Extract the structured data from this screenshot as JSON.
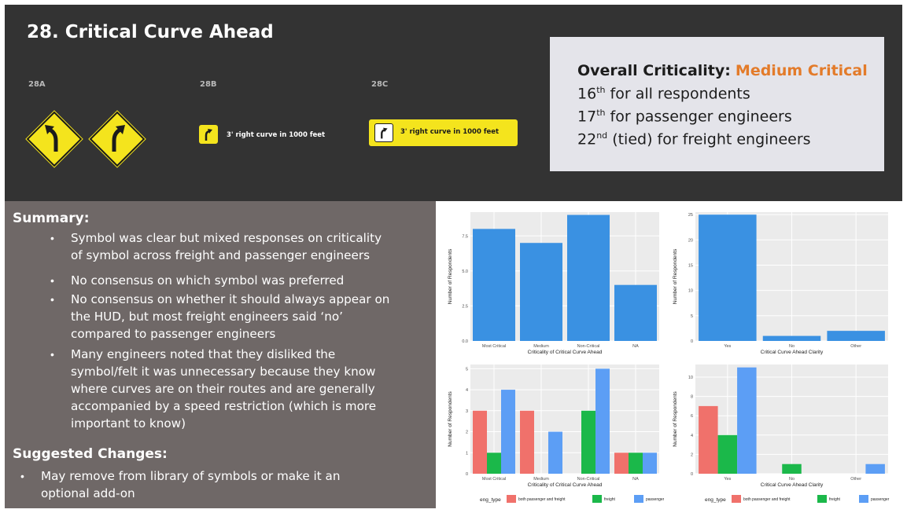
{
  "slide": {
    "title": "28. Critical Curve Ahead",
    "signs": [
      {
        "label": "28A"
      },
      {
        "label": "28B",
        "plate_text": "3' right curve in 1000 feet"
      },
      {
        "label": "28C",
        "plate_text": "3' right curve in 1000 feet"
      }
    ],
    "criticality": {
      "label": "Overall Criticality:",
      "value": "Medium Critical",
      "value_color": "#e37b2a",
      "lines": [
        {
          "num": "16",
          "sup": "th",
          "text": " for all respondents"
        },
        {
          "num": "17",
          "sup": "th",
          "text": " for passenger engineers"
        },
        {
          "num": "22",
          "sup": "nd",
          "text": " (tied) for freight engineers"
        }
      ]
    },
    "summary": {
      "heading": "Summary:",
      "bullets": [
        [
          "Symbol was clear but mixed responses on criticality",
          "of symbol across freight and passenger engineers"
        ],
        [
          "No consensus on which symbol was preferred"
        ],
        [
          "No consensus on whether it should always appear on",
          "the HUD, but most freight engineers said ‘no’",
          "compared to passenger engineers"
        ],
        [
          "Many engineers noted that they disliked the",
          "symbol/felt it was unnecessary because they know",
          "where curves are on their routes and are generally",
          "accompanied by a speed restriction (which is more",
          "important to know)"
        ]
      ]
    },
    "suggested": {
      "heading": "Suggested Changes:",
      "bullets": [
        [
          "May remove from library of symbols or make it an",
          "optional add-on"
        ]
      ]
    }
  },
  "chart_data": [
    {
      "type": "bar",
      "categories": [
        "Most Critical",
        "Medium",
        "Non-Critical",
        "NA"
      ],
      "values": [
        8,
        7,
        9,
        4
      ],
      "xlabel": "Criticality of Critical Curve Ahead",
      "ylabel": "Number of Respondents",
      "yticks": [
        "0.0",
        "2.5",
        "5.0",
        "7.5"
      ],
      "ytick_values": [
        0,
        2.5,
        5,
        7.5
      ],
      "ylim": [
        0,
        9.2
      ],
      "color": "#3a91e2"
    },
    {
      "type": "bar",
      "categories": [
        "Yes",
        "No",
        "Other"
      ],
      "values": [
        25,
        1,
        2
      ],
      "xlabel": "Critical Curve Ahead Clarity",
      "ylabel": "Number of Respondents",
      "yticks": [
        "0",
        "5",
        "10",
        "15",
        "20",
        "25"
      ],
      "ytick_values": [
        0,
        5,
        10,
        15,
        20,
        25
      ],
      "ylim": [
        0,
        25.5
      ],
      "color": "#3a91e2"
    },
    {
      "type": "bar",
      "categories": [
        "Most Critical",
        "Medium",
        "Non-Critical",
        "NA"
      ],
      "series": [
        {
          "name": "both passenger and freight",
          "values": [
            3,
            3,
            0,
            1
          ]
        },
        {
          "name": "freight",
          "values": [
            1,
            0,
            3,
            1
          ]
        },
        {
          "name": "passenger",
          "values": [
            4,
            2,
            5,
            1
          ]
        }
      ],
      "xlabel": "Criticality of Critical Curve Ahead",
      "ylabel": "Number of Respondents",
      "yticks": [
        "0",
        "1",
        "2",
        "3",
        "4",
        "5"
      ],
      "ytick_values": [
        0,
        1,
        2,
        3,
        4,
        5
      ],
      "ylim": [
        0,
        5.2
      ],
      "legend_title": "eng_type",
      "legend_position": "bottom"
    },
    {
      "type": "bar",
      "categories": [
        "Yes",
        "No",
        "Other"
      ],
      "series": [
        {
          "name": "both passenger and freight",
          "values": [
            7,
            0,
            0
          ]
        },
        {
          "name": "freight",
          "values": [
            4,
            1,
            0
          ]
        },
        {
          "name": "passenger",
          "values": [
            11,
            0,
            1
          ]
        }
      ],
      "xlabel": "Critical Curve Ahead Clarity",
      "ylabel": "Number of Respondents",
      "yticks": [
        "0",
        "2",
        "4",
        "6",
        "8",
        "10"
      ],
      "ytick_values": [
        0,
        2,
        4,
        6,
        8,
        10
      ],
      "ylim": [
        0,
        11.3
      ],
      "legend_title": "eng_type",
      "legend_position": "bottom"
    }
  ],
  "colors": {
    "both": "#f0716b",
    "freight": "#1bb84a",
    "passenger": "#5c9ef5",
    "panel": "#ebebeb",
    "sign_yellow": "#f4e41d"
  }
}
